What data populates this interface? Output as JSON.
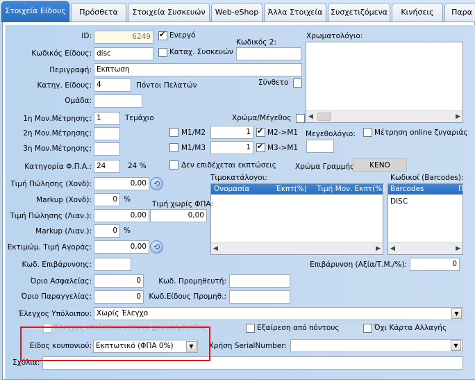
{
  "tabs": [
    "Στοιχεία Είδους",
    "Πρόσθετα",
    "Στοιχεία Συσκευών",
    "Web-eShop",
    "Άλλα Στοιχεία",
    "Συσχετιζόμενα",
    "Κινήσεις",
    "Παρα"
  ],
  "fields": {
    "id_label": "ID:",
    "id_value": "6249",
    "active_label": "Ενεργό",
    "code2_label": "Κωδικός 2:",
    "code_label": "Κωδικός Είδους:",
    "code_value": "disc",
    "device_reg_label": "Καταχ. Συσκευών",
    "desc_label": "Περιγραφή:",
    "desc_value": "Εκπτωση",
    "category_label": "Κατηγ. Είδους:",
    "category_value": "4",
    "category_name": "Πόντοι Πελατών",
    "composite_label": "Σύνθετο",
    "group_label": "Ομάδα:",
    "unit1_label": "1η Μον.Μέτρησης:",
    "unit1_value": "1",
    "unit1_name": "Τεμάχιο",
    "unit2_label": "2η Μον.Μέτρησης:",
    "unit3_label": "3η Μον.Μέτρησης:",
    "color_size_label": "Χρώμα/Μέγεθος",
    "m1m2_label": "M1/M2",
    "m1m2_value": "1",
    "m2m1_label": "M2->M1",
    "m1m3_label": "M1/M3",
    "m1m3_value": "1",
    "m3m1_label": "M3->M1",
    "size_chart_label": "Μεγεθολόγιο:",
    "online_scale_label": "Μέτρηση online ζυγαριάς",
    "vat_label": "Κατηγορία Φ.Π.Α.:",
    "vat_value": "24",
    "vat_percent": "24 %",
    "no_discount_label": "Δεν επιδέχεται εκπτώσεις",
    "line_color_label": "Χρώμα Γραμμής:",
    "line_color_value": "ΚΕΝΟ",
    "color_chart_label": "Χρωματολόγιο:",
    "price_wh_label": "Τιμή Πώλησης (Χονδ):",
    "price_wh_value": "0,00",
    "markup_wh_label": "Markup (Χονδ):",
    "markup_wh_value": "0",
    "pct": "%",
    "price_novat_label": "Τιμή χωρίς ΦΠΑ:",
    "price_novat_value": "0,00",
    "price_rt_label": "Τιμή Πώλησης (Λιαν.):",
    "price_rt_value": "0,00",
    "markup_rt_label": "Markup (Λιαν.):",
    "markup_rt_value": "0",
    "purchase_label": "Εκτιμώμ. Τιμή Αγοράς:",
    "purchase_value": "0,00",
    "surcharge_code_label": "Κωδ. Επιβάρυνσης:",
    "surcharge_label": "Επιβάρυνση (Αξία/Τ.Μ./%):",
    "surcharge_value": "0",
    "insurance_label": "Όριο Ασφαλείας:",
    "insurance_value": "0",
    "supplier_label": "Κωδ. Προμηθευτή:",
    "order_label": "Όριο Παραγγελίας:",
    "order_value": "0",
    "supplier_item_label": "Κωδ.Είδους Προμηθ.:",
    "balance_label": "Έλεγχος Υπόλοιπου:",
    "balance_value": "Χωρίς Έλεγχο",
    "balance_color_label": "Έλεγχος υπολοίπου κατανα χρώμα/μέγεθος",
    "exclude_points_label": "Εξαίρεση από πόντους",
    "no_gift_card_label": "Όχι Κάρτα Αλλαγής",
    "coupon_label": "Είδος κουπονιού:",
    "coupon_value": "Εκπτωτικό (ΦΠΑ 0%)",
    "serial_label": "Χρήση SerialNumber:",
    "comments_label": "Σχόλια:"
  },
  "price_list": {
    "title": "Τιμοκατάλογοι:",
    "columns": [
      "Ονομασία",
      "Έκπτ(%)",
      "Τιμή Μον. Εκπτ(%)"
    ]
  },
  "barcodes": {
    "title": "Κωδικοί (Barcodes):",
    "column": "Barcodes",
    "column2": "Π",
    "rows": [
      "DISC"
    ]
  }
}
